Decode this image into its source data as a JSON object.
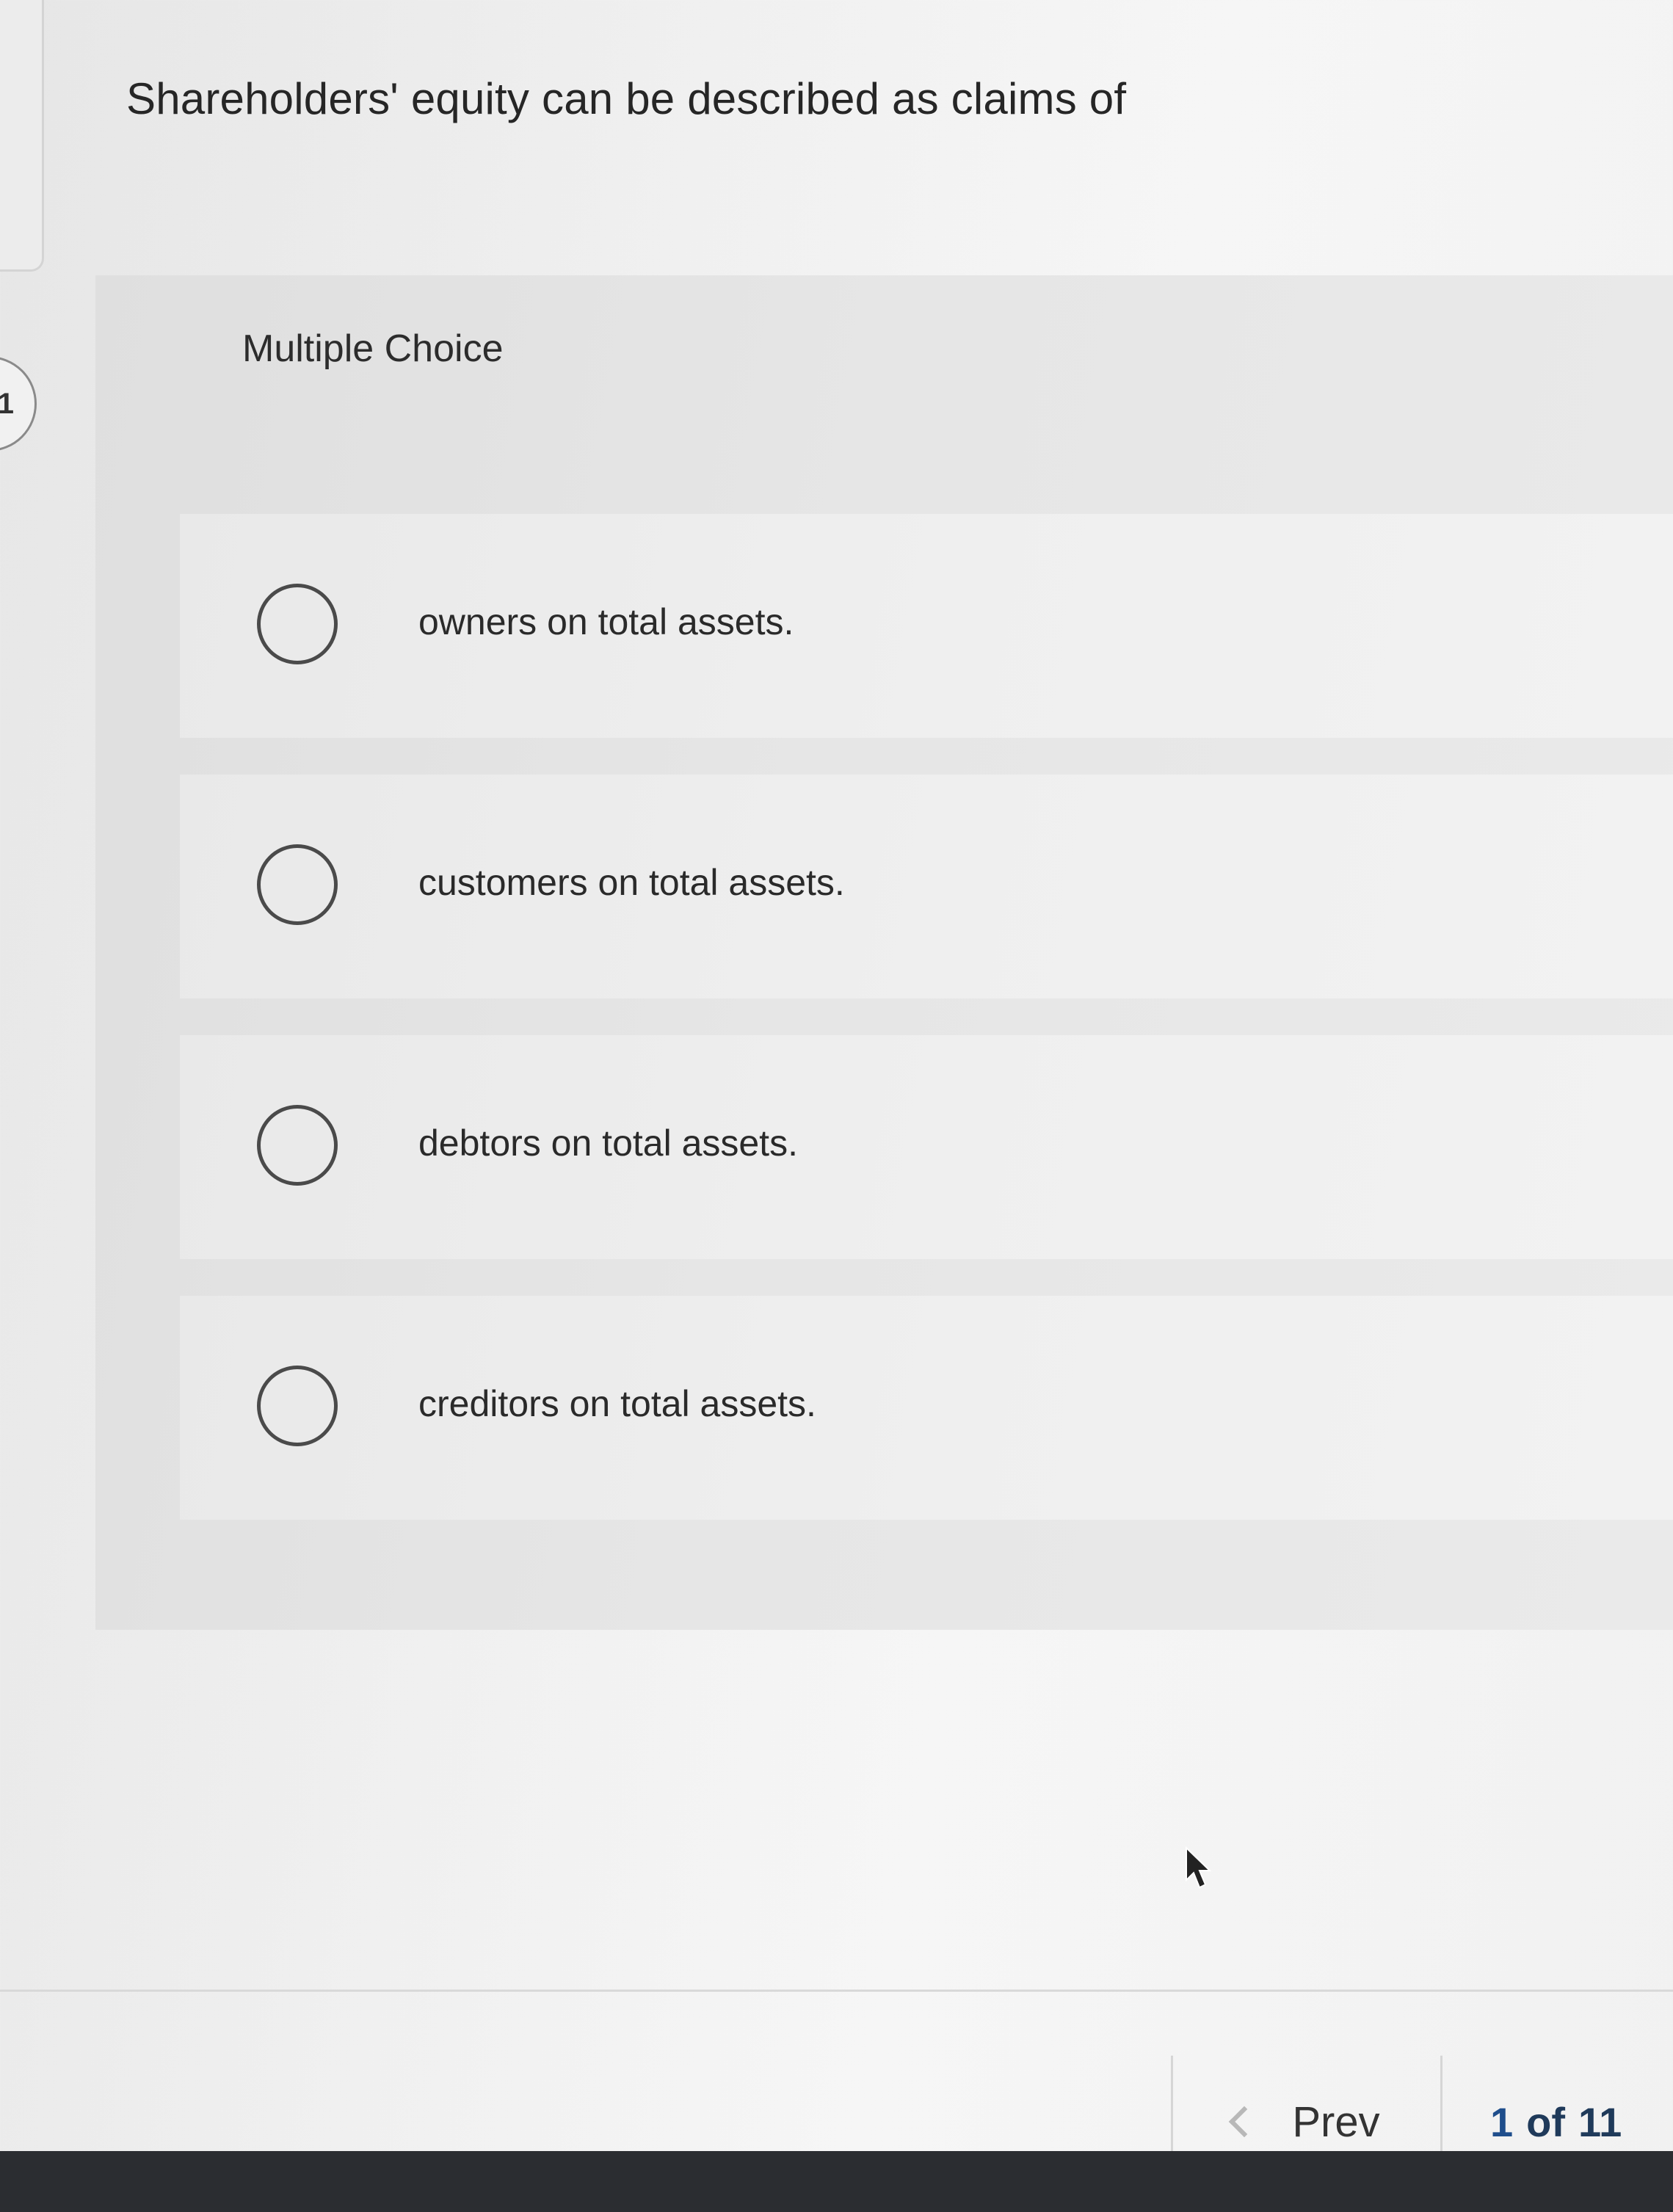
{
  "question": {
    "number": "1",
    "text": "Shareholders' equity can be described as claims of"
  },
  "multiple_choice": {
    "label": "Multiple Choice",
    "options": [
      {
        "label": "owners on total assets.",
        "selected": false
      },
      {
        "label": "customers on total assets.",
        "selected": false
      },
      {
        "label": "debtors on total assets.",
        "selected": false
      },
      {
        "label": "creditors on total assets.",
        "selected": false
      }
    ]
  },
  "pagination": {
    "prev_label": "Prev",
    "current": "1",
    "of_label": "of",
    "total": "11"
  },
  "icons": {
    "prev": "chevron-left-icon",
    "cursor": "mouse-pointer-icon"
  }
}
